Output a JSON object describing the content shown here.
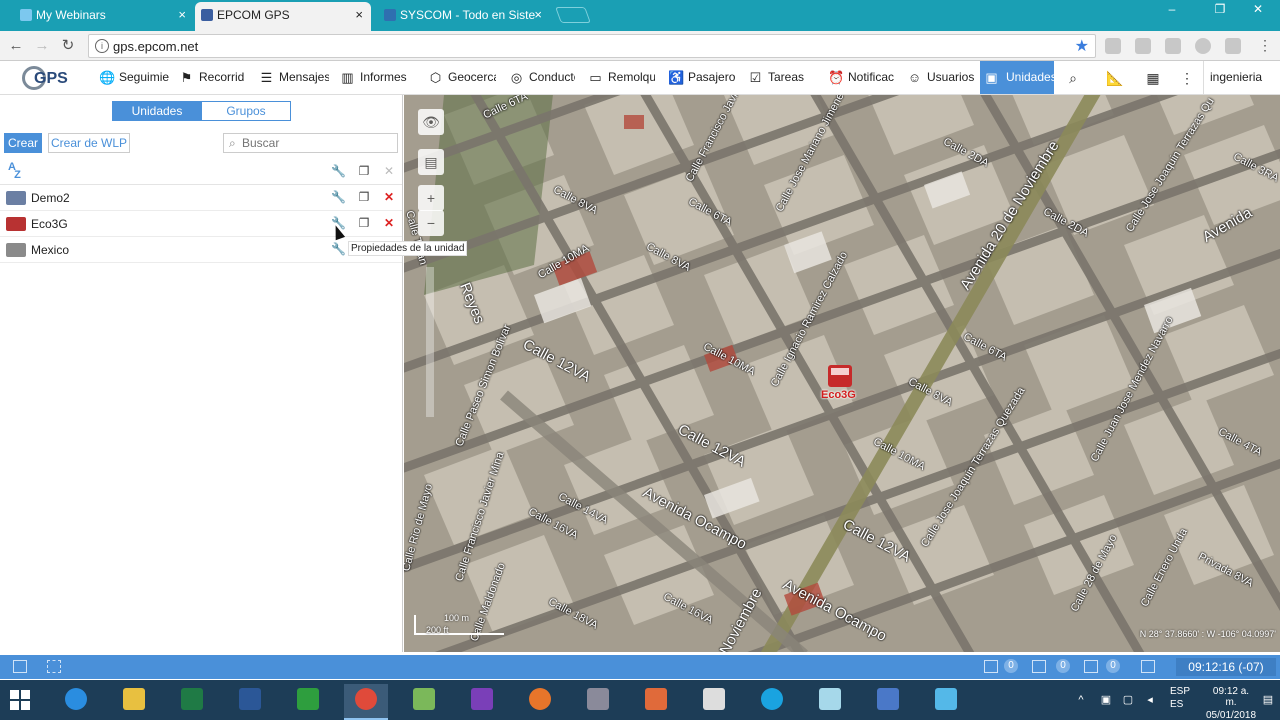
{
  "browser": {
    "tabs": [
      {
        "title": "My Webinars",
        "close": "×"
      },
      {
        "title": "EPCOM GPS",
        "close": "×"
      },
      {
        "title": "SYSCOM - Todo en Siste",
        "close": "×"
      }
    ],
    "url": "gps.epcom.net",
    "window_controls": [
      "–",
      "❐",
      "✕"
    ]
  },
  "app": {
    "logo": "GPS",
    "menu": [
      {
        "label": "Seguimie",
        "icon": "globe-icon",
        "glyph": "🌐"
      },
      {
        "label": "Recorrid",
        "icon": "flag-icon",
        "glyph": "⚑"
      },
      {
        "label": "Mensajes",
        "icon": "message-icon",
        "glyph": "☰"
      },
      {
        "label": "Informes",
        "icon": "report-icon",
        "glyph": "▥"
      },
      {
        "label": "Geocerca",
        "icon": "geofence-icon",
        "glyph": "⬡"
      },
      {
        "label": "Conducto",
        "icon": "steering-wheel-icon",
        "glyph": "◎"
      },
      {
        "label": "Remolqu",
        "icon": "trailer-icon",
        "glyph": "▭"
      },
      {
        "label": "Pasajero",
        "icon": "passenger-icon",
        "glyph": "♿"
      },
      {
        "label": "Tareas",
        "icon": "tasks-icon",
        "glyph": "☑"
      },
      {
        "label": "Notificac",
        "icon": "alarm-icon",
        "glyph": "⏰"
      },
      {
        "label": "Usuarios",
        "icon": "user-icon",
        "glyph": "☺"
      },
      {
        "label": "Unidades",
        "icon": "units-icon",
        "glyph": "▣"
      }
    ],
    "username": "ingenieria",
    "accent": "#4a90d9"
  },
  "left_panel": {
    "tabs": [
      "Unidades",
      "Grupos"
    ],
    "create_button": "Crear",
    "create_wlp_button": "Crear de WLP",
    "search_placeholder": "Buscar",
    "sort_icon": "A→Z",
    "units": [
      {
        "name": "Demo2",
        "icon_color": "#6b7fa3"
      },
      {
        "name": "Eco3G",
        "icon_color": "#b83232"
      },
      {
        "name": "Mexico",
        "icon_color": "#8a8a8a"
      }
    ],
    "tooltip": "Propiedades de la unidad"
  },
  "map": {
    "streets": [
      "Calle 6TA",
      "Calle Francisco Javie",
      "Calle Jose Mariano Jimene",
      "Calle 2DA",
      "Avenida 20 de Noviembre",
      "Calle Jose Joaquin Terrazas Qu",
      "Calle 3RA",
      "Calle 8VA",
      "Calle 6TA",
      "Calle 2DA",
      "Avenida",
      "Calle 8VA",
      "Calle 10MA",
      "Calle Ignacio Ramirez Calzado",
      "Calle 6TA",
      "Calle 12VA",
      "Calle Paseo Simon Bolivar",
      "Calle 10MA",
      "Calle 8VA",
      "Calle Juan Jose Mendez Navarro",
      "Calle 4TA",
      "Calle 12VA",
      "Calle Jose Joaquin Terrazas Quezada",
      "Calle 10MA",
      "Avenida Ocampo",
      "Calle 12VA",
      "Calle Rio de Mayo",
      "Calle Francisco Javier Mina",
      "Calle 16VA",
      "Calle 14VA",
      "Calle 28 de Mayo",
      "Calle Enero Unda",
      "Privada 8VA",
      "Avenida Ocampo",
      "Calle 18VA",
      "Calle 16VA",
      "Calle Maldonado",
      "Noviembre",
      "Calle Teran",
      "Reyes"
    ],
    "unit_label": "Eco3G",
    "scale": [
      "100 m",
      "200 ft"
    ],
    "coordinates": "N 28° 37.8660' : W -106° 04.0997'"
  },
  "status_bar": {
    "counts": [
      "0",
      "0",
      "0"
    ],
    "clock": "09:12:16 (-07)"
  },
  "taskbar": {
    "apps": [
      "internet-explorer",
      "file-explorer",
      "excel",
      "word",
      "store",
      "chrome",
      "android-studio",
      "visual-studio",
      "firefox",
      "sql-tool",
      "paint",
      "unity",
      "skype",
      "notepad",
      "dotnet",
      "snowflake-app"
    ],
    "lang": "ESP",
    "lang2": "ES",
    "time": "09:12 a. m.",
    "date": "05/01/2018"
  }
}
